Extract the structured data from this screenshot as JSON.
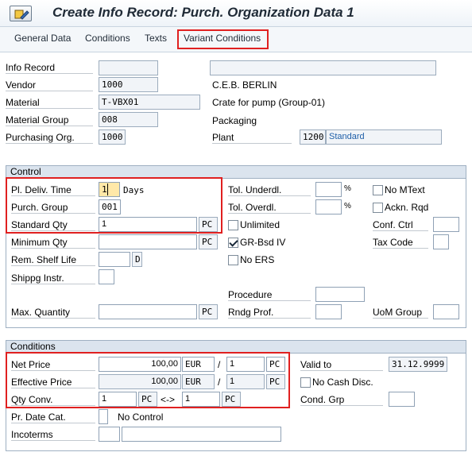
{
  "title": "Create Info Record: Purch. Organization Data 1",
  "tabs": [
    "General Data",
    "Conditions",
    "Texts",
    "Variant Conditions"
  ],
  "header": {
    "info_record_label": "Info Record",
    "info_record_value": "",
    "info_record_desc": "",
    "vendor_label": "Vendor",
    "vendor_value": "1000",
    "vendor_name": "C.E.B. BERLIN",
    "material_label": "Material",
    "material_value": "T-VBX01",
    "material_desc": "Crate for pump (Group-01)",
    "material_group_label": "Material Group",
    "material_group_value": "008",
    "material_group_desc": "Packaging",
    "purch_org_label": "Purchasing Org.",
    "purch_org_value": "1000",
    "plant_label": "Plant",
    "plant_value": "1200",
    "plant_desc": "Standard"
  },
  "control": {
    "title": "Control",
    "pl_deliv_time_label": "Pl. Deliv. Time",
    "pl_deliv_time_value": "1",
    "days_label": "Days",
    "purch_group_label": "Purch. Group",
    "purch_group_value": "001",
    "standard_qty_label": "Standard Qty",
    "standard_qty_value": "1",
    "standard_qty_unit": "PC",
    "minimum_qty_label": "Minimum Qty",
    "minimum_qty_value": "",
    "minimum_qty_unit": "PC",
    "rem_shelf_life_label": "Rem. Shelf Life",
    "rem_shelf_life_unit": "D",
    "shippg_instr_label": "Shippg Instr.",
    "max_quantity_label": "Max. Quantity",
    "max_quantity_unit": "PC",
    "tol_underdl_label": "Tol. Underdl.",
    "tol_overdl_label": "Tol. Overdl.",
    "percent": "%",
    "unlimited_label": "Unlimited",
    "unlimited_checked": false,
    "gr_bsd_iv_label": "GR-Bsd IV",
    "gr_bsd_iv_checked": true,
    "no_ers_label": "No ERS",
    "no_ers_checked": false,
    "procedure_label": "Procedure",
    "rndg_prof_label": "Rndg Prof.",
    "no_mtext_label": "No MText",
    "no_mtext_checked": false,
    "ackn_rqd_label": "Ackn. Rqd",
    "ackn_rqd_checked": false,
    "conf_ctrl_label": "Conf. Ctrl",
    "tax_code_label": "Tax Code",
    "uom_group_label": "UoM Group"
  },
  "conditions": {
    "title": "Conditions",
    "net_price_label": "Net Price",
    "net_price_value": "100,00",
    "net_price_currency": "EUR",
    "net_price_per": "1",
    "net_price_unit": "PC",
    "effective_price_label": "Effective Price",
    "effective_price_value": "100,00",
    "effective_price_currency": "EUR",
    "effective_price_per": "1",
    "effective_price_unit": "PC",
    "slash": "/",
    "qty_conv_label": "Qty Conv.",
    "qty_conv_value1": "1",
    "qty_conv_unit1": "PC",
    "qty_conv_arrow": "<->",
    "qty_conv_value2": "1",
    "qty_conv_unit2": "PC",
    "valid_to_label": "Valid to",
    "valid_to_value": "31.12.9999",
    "no_cash_disc_label": "No Cash Disc.",
    "no_cash_disc_checked": false,
    "cond_grp_label": "Cond. Grp",
    "pr_date_cat_label": "Pr. Date Cat.",
    "pr_date_cat_desc": "No Control",
    "incoterms_label": "Incoterms"
  },
  "colors": {
    "highlight": "#e02020",
    "group_header": "#dbe4ee",
    "link": "#1f5fa8"
  }
}
